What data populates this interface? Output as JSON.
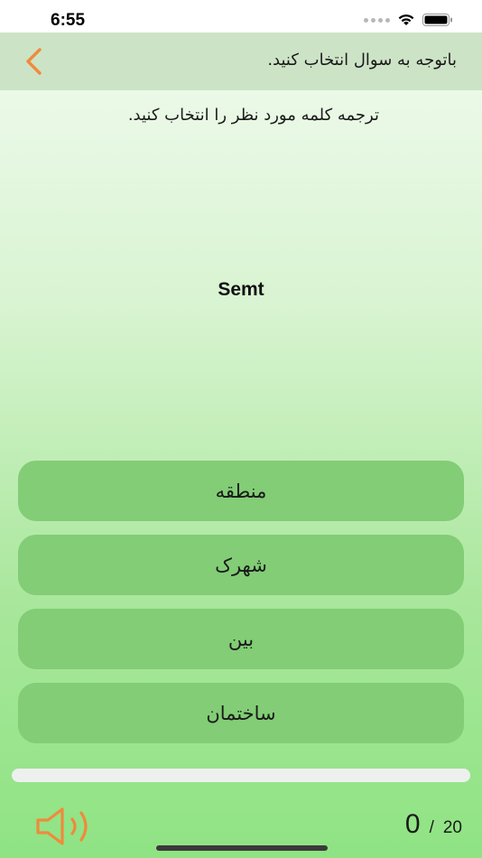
{
  "status_bar": {
    "time": "6:55"
  },
  "header": {
    "title": "باتوجه به سوال انتخاب کنید.",
    "back_icon": "chevron-left-icon"
  },
  "question": {
    "instruction": "ترجمه کلمه مورد نظر را انتخاب کنید.",
    "word": "Semt"
  },
  "options": [
    {
      "label": "منطقه"
    },
    {
      "label": "شهرک"
    },
    {
      "label": "بین"
    },
    {
      "label": "ساختمان"
    }
  ],
  "progress": {
    "fraction": 0
  },
  "footer": {
    "score": "0",
    "separator": "/",
    "total": "20",
    "speaker_icon": "speaker-icon"
  },
  "colors": {
    "accent": "#f08a3c",
    "option_bg": "#82cd76",
    "header_bg": "#cde3c6"
  }
}
